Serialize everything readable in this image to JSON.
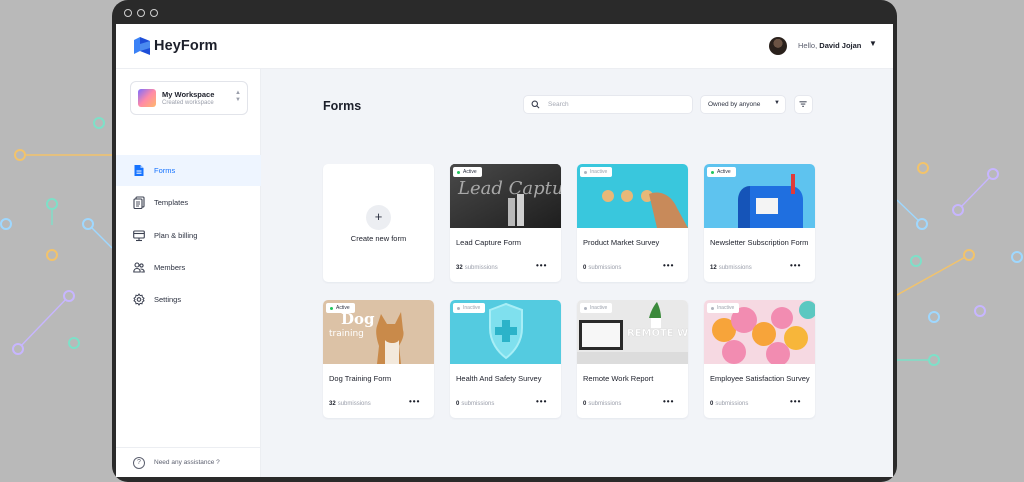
{
  "app": {
    "name": "HeyForm"
  },
  "user": {
    "greeting": "Hello,",
    "name": "David Jojan"
  },
  "workspace": {
    "name": "My Workspace",
    "subtitle": "Created workspace"
  },
  "sidebar": {
    "items": [
      {
        "label": "Forms",
        "icon": "document-icon",
        "active": true
      },
      {
        "label": "Templates",
        "icon": "templates-icon",
        "active": false
      },
      {
        "label": "Plan & billing",
        "icon": "billing-icon",
        "active": false
      },
      {
        "label": "Members",
        "icon": "members-icon",
        "active": false
      },
      {
        "label": "Settings",
        "icon": "gear-icon",
        "active": false
      }
    ],
    "help": "Need any assistance ?"
  },
  "main": {
    "title": "Forms",
    "search_placeholder": "Search",
    "owner_filter": "Owned by anyone",
    "create_label": "Create new form",
    "submissions_label": "submissions",
    "forms": [
      {
        "title": "Lead Capture Form",
        "status": "Active",
        "count": "32"
      },
      {
        "title": "Product Market Survey",
        "status": "Inactive",
        "count": "0"
      },
      {
        "title": "Newsletter Subscription Form",
        "status": "Active",
        "count": "12"
      },
      {
        "title": "Dog Training Form",
        "status": "Active",
        "count": "32"
      },
      {
        "title": "Health And Safety Survey",
        "status": "Inactive",
        "count": "0"
      },
      {
        "title": "Remote Work Report",
        "status": "Inactive",
        "count": "0"
      },
      {
        "title": "Employee Satisfaction Survey",
        "status": "Inactive",
        "count": "0"
      }
    ],
    "thumb_text": {
      "lead": "Lead Capture",
      "dog": "Dog",
      "dog_sub": "training",
      "remote": "REMOTE WORK"
    }
  },
  "colors": {
    "accent": "#1673ff",
    "active_dot": "#22c55e",
    "inactive_dot": "#b0b5bf"
  }
}
